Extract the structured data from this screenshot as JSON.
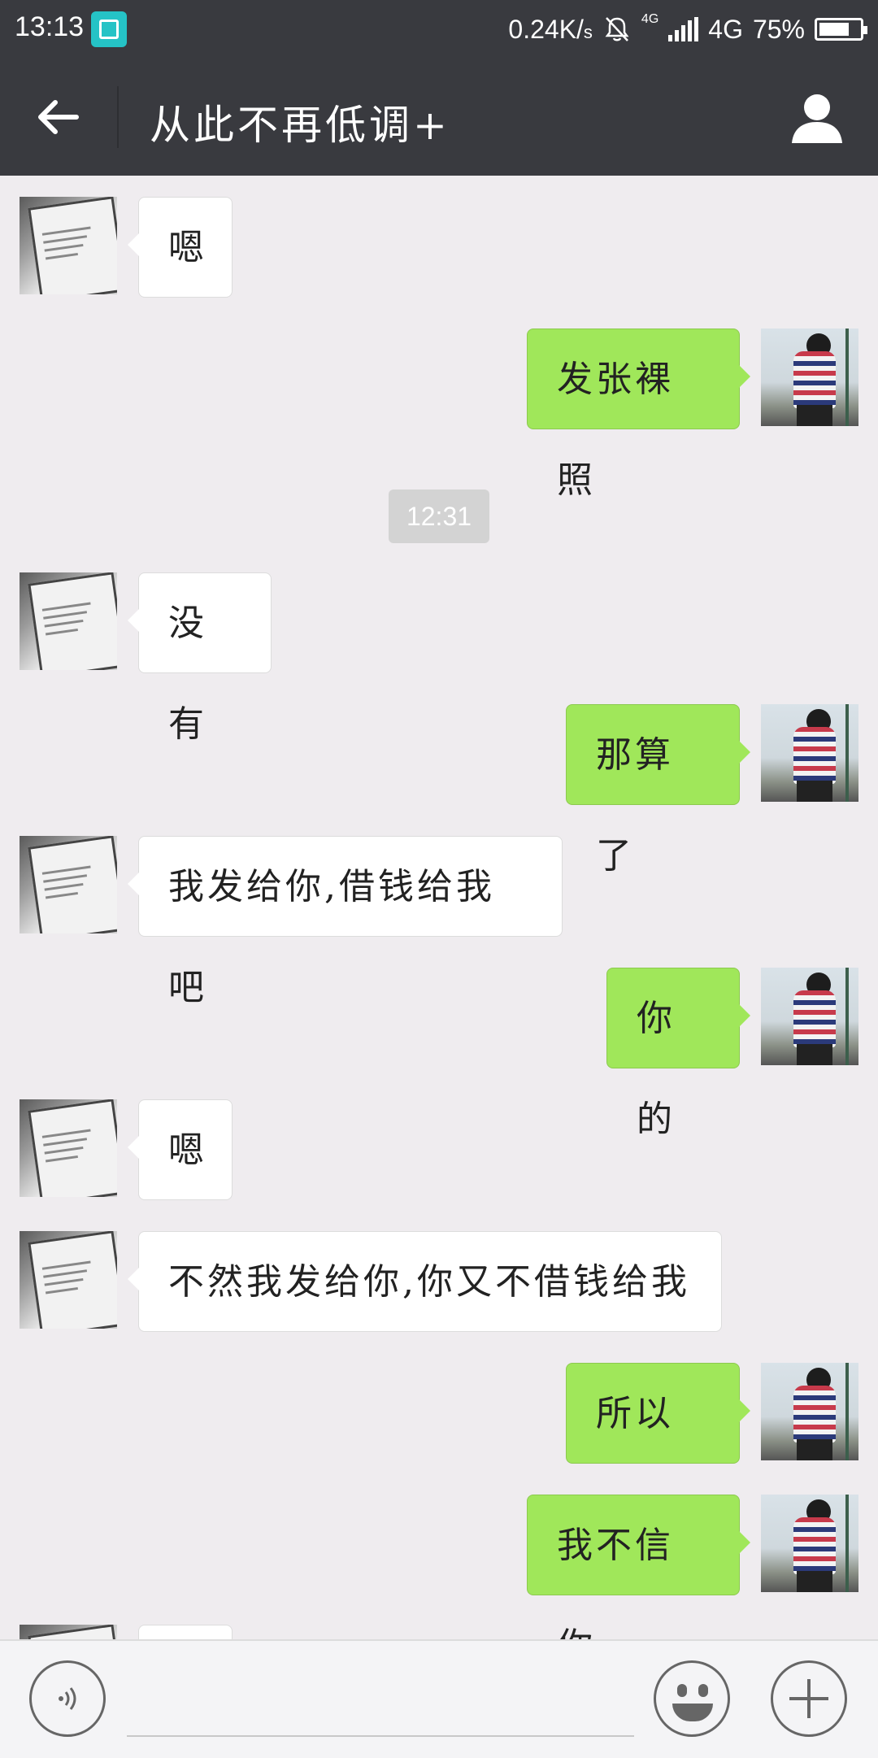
{
  "status_bar": {
    "time": "13:13",
    "speed": "0.24K/",
    "speed_unit": "s",
    "network": "4G",
    "network_small": "4G",
    "battery": "75%",
    "battery_level": 0.75
  },
  "header": {
    "title": "从此不再低调+"
  },
  "messages": [
    {
      "side": "in",
      "text": "嗯"
    },
    {
      "side": "out",
      "text": "发张裸照"
    },
    {
      "side": "in",
      "text": "没有"
    },
    {
      "side": "out",
      "text": "那算了"
    },
    {
      "side": "in",
      "text": "我发给你,借钱给我吧"
    },
    {
      "side": "out",
      "text": "你的"
    },
    {
      "side": "in",
      "text": "嗯"
    },
    {
      "side": "in",
      "text": "不然我发给你,你又不借钱给我"
    },
    {
      "side": "out",
      "text": "所以啊"
    },
    {
      "side": "out",
      "text": "我不信你"
    }
  ],
  "timestamp": "12:31",
  "input_bar": {
    "voice_icon": "voice-icon",
    "emoji_icon": "emoji-icon",
    "plus_icon": "plus-icon"
  },
  "colors": {
    "bar": "#393a3f",
    "chat_bg": "#efecef",
    "outgoing": "#a0e75a",
    "incoming": "#ffffff"
  }
}
